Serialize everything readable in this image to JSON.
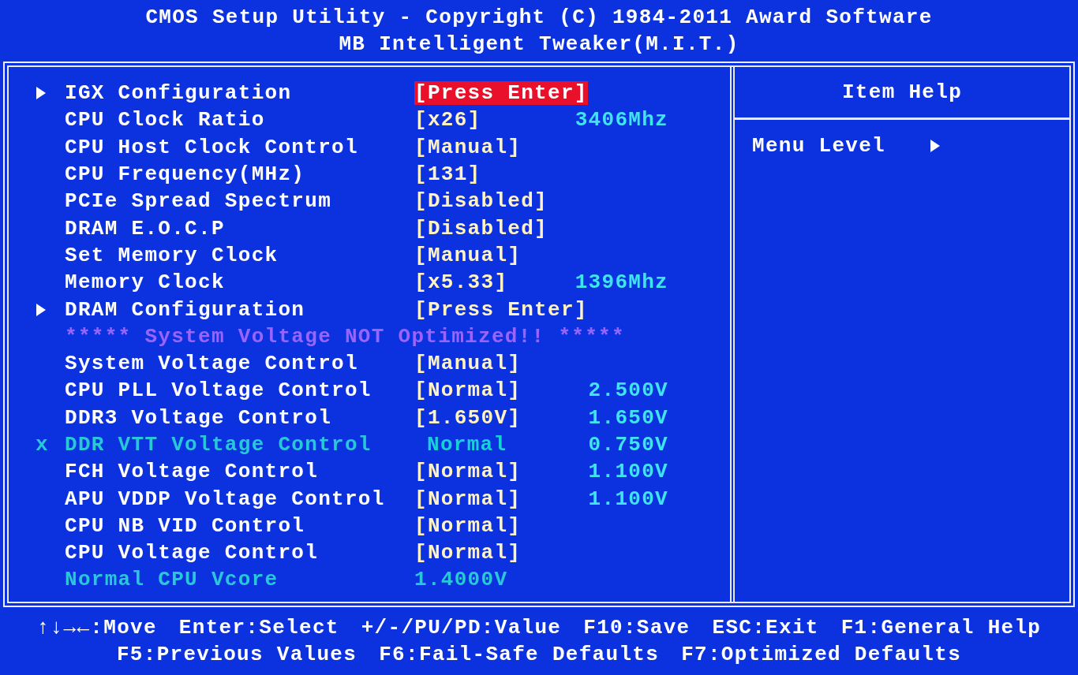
{
  "header": {
    "title": "CMOS Setup Utility - Copyright (C) 1984-2011 Award Software",
    "subtitle": "MB Intelligent Tweaker(M.I.T.)"
  },
  "items": [
    {
      "kind": "submenu",
      "label": "IGX Configuration",
      "value": "[Press Enter]",
      "selected": true
    },
    {
      "kind": "setting",
      "label": "CPU Clock Ratio",
      "value": "[x26]",
      "reading": "3406Mhz",
      "selected": false
    },
    {
      "kind": "setting",
      "label": "CPU Host Clock Control",
      "value": "[Manual]",
      "selected": false
    },
    {
      "kind": "setting",
      "label": "CPU Frequency(MHz)",
      "value": "[131]",
      "selected": false
    },
    {
      "kind": "setting",
      "label": "PCIe Spread Spectrum",
      "value": "[Disabled]",
      "selected": false
    },
    {
      "kind": "setting",
      "label": "DRAM E.O.C.P",
      "value": "[Disabled]",
      "selected": false
    },
    {
      "kind": "setting",
      "label": "Set Memory Clock",
      "value": "[Manual]",
      "selected": false
    },
    {
      "kind": "setting",
      "label": "Memory Clock",
      "value": "[x5.33]",
      "reading": "1396Mhz",
      "selected": false
    },
    {
      "kind": "submenu",
      "label": "DRAM Configuration",
      "value": "[Press Enter]",
      "selected": false
    },
    {
      "kind": "warning",
      "label": "***** System Voltage NOT Optimized!! *****"
    },
    {
      "kind": "setting",
      "label": "System Voltage Control",
      "value": "[Manual]",
      "selected": false
    },
    {
      "kind": "setting",
      "label": "CPU PLL Voltage Control",
      "value": "[Normal]",
      "reading": "2.500V",
      "selected": false
    },
    {
      "kind": "setting",
      "label": "DDR3 Voltage Control",
      "value": "[1.650V]",
      "reading": "1.650V",
      "selected": false
    },
    {
      "kind": "locked",
      "marker": "x",
      "label": "DDR VTT Voltage Control",
      "value": "Normal",
      "reading": "0.750V",
      "selected": false
    },
    {
      "kind": "setting",
      "label": "FCH Voltage Control",
      "value": "[Normal]",
      "reading": "1.100V",
      "selected": false
    },
    {
      "kind": "setting",
      "label": "APU VDDP Voltage Control",
      "value": "[Normal]",
      "reading": "1.100V",
      "selected": false
    },
    {
      "kind": "setting",
      "label": "CPU NB VID Control",
      "value": "[Normal]",
      "selected": false
    },
    {
      "kind": "setting",
      "label": "CPU Voltage Control",
      "value": "[Normal]",
      "selected": false
    },
    {
      "kind": "info",
      "label": "Normal CPU Vcore",
      "value": "1.4000V",
      "selected": false
    }
  ],
  "help": {
    "title": "Item Help",
    "menu_level": "Menu Level"
  },
  "footer": [
    [
      "↑↓→←:Move",
      "Enter:Select",
      "+/-/PU/PD:Value",
      "F10:Save",
      "ESC:Exit",
      "F1:General Help"
    ],
    [
      "F5:Previous Values",
      "F6:Fail-Safe Defaults",
      "F7:Optimized Defaults"
    ]
  ]
}
